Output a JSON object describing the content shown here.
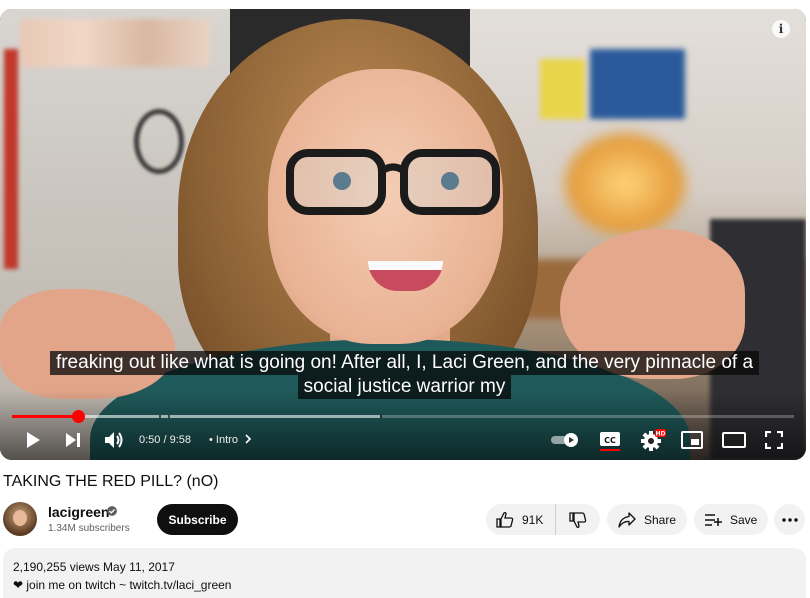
{
  "player": {
    "info_icon": "info-icon",
    "captions": {
      "line1": "freaking out like what is going on! After all, I, Laci Green, and the very pinnacle of a",
      "line2": "social justice warrior my"
    },
    "progress": {
      "played_fraction": 0.085,
      "accent": "#ff0000"
    },
    "time_current": "0:50",
    "time_total": "9:58",
    "time_display": "0:50 / 9:58",
    "separator": "•",
    "chapter_label": "Intro",
    "quality_badge": "HD"
  },
  "video": {
    "title": "TAKING THE RED PILL? (nO)"
  },
  "channel": {
    "name": "lacigreen",
    "subscribers": "1.34M subscribers",
    "subscribe_label": "Subscribe"
  },
  "actions": {
    "likes": "91K",
    "share_label": "Share",
    "save_label": "Save"
  },
  "description": {
    "meta": "2,190,255 views  May 11, 2017",
    "text": "❤ join me on twitch ~ twitch.tv/laci_green"
  }
}
